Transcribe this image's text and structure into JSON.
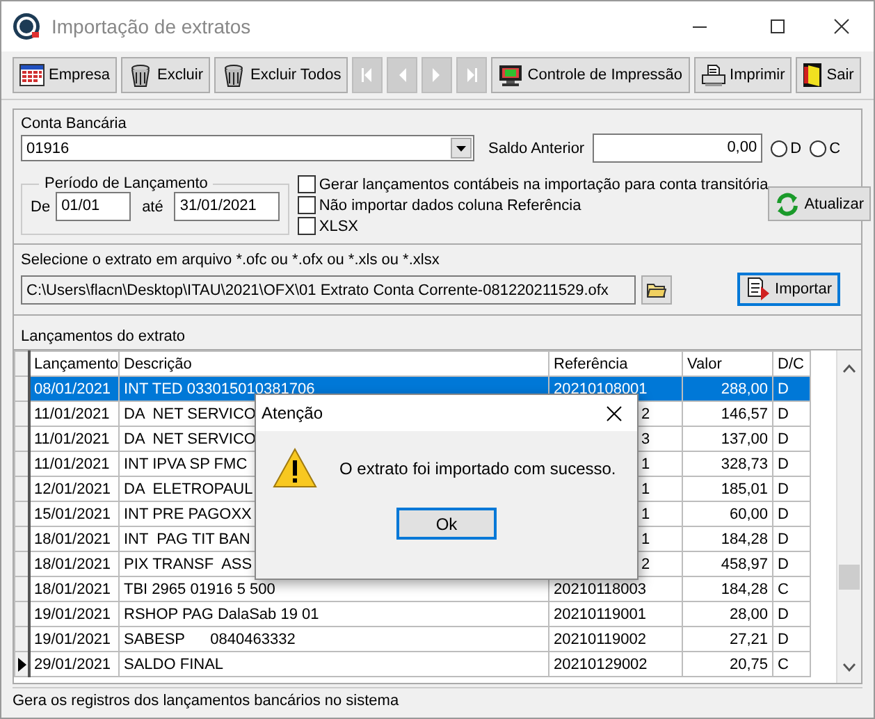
{
  "window": {
    "title": "Importação de extratos"
  },
  "toolbar": [
    {
      "kind": "calendar",
      "label": "Empresa",
      "disabled": false
    },
    {
      "kind": "trash",
      "label": "Excluir",
      "disabled": false
    },
    {
      "kind": "trash",
      "label": "Excluir Todos",
      "disabled": false
    },
    {
      "kind": "first",
      "disabled": true
    },
    {
      "kind": "prev",
      "disabled": true
    },
    {
      "kind": "next",
      "disabled": true
    },
    {
      "kind": "last",
      "disabled": true
    },
    {
      "kind": "monitor",
      "label": "Controle de Impressão",
      "disabled": false
    },
    {
      "kind": "printer",
      "label": "Imprimir",
      "disabled": false
    },
    {
      "kind": "exit",
      "label": "Sair",
      "disabled": false
    }
  ],
  "conta_bancaria": {
    "label": "Conta Bancária",
    "value": "01916"
  },
  "saldo_anterior": {
    "label": "Saldo Anterior",
    "value": "0,00"
  },
  "saldo_tipo": [
    {
      "label": "D",
      "selected": false
    },
    {
      "label": "C",
      "selected": false
    }
  ],
  "periodo": {
    "title": "Período de Lançamento",
    "from_label": "De",
    "from": "01/01",
    "to_label": "até",
    "to": "31/01/2021"
  },
  "options": [
    {
      "label": "Gerar lançamentos contábeis na importação para conta transitória",
      "checked": false
    },
    {
      "label": "Não importar dados coluna Referência",
      "checked": false
    },
    {
      "label": "XLSX",
      "checked": false
    }
  ],
  "atualizar_button": "Atualizar",
  "file": {
    "label": "Selecione o extrato em arquivo *.ofc ou *.ofx ou *.xls ou *.xlsx",
    "value": "C:\\Users\\flacn\\Desktop\\ITAU\\2021\\OFX\\01 Extrato Conta Corrente-081220211529.ofx"
  },
  "importar_button": "Importar",
  "entries": {
    "title": "Lançamentos do extrato",
    "columns": [
      "Lançamento",
      "Descrição",
      "Referência",
      "Valor",
      "D/C"
    ],
    "rows": [
      {
        "cells": [
          "08/01/2021",
          "INT TED 033015010381706",
          "20210108001",
          "288,00",
          "D"
        ],
        "selected": true,
        "current": false
      },
      {
        "cells": [
          "11/01/2021",
          "DA  NET SERVICO",
          "2",
          "146,57",
          "D"
        ],
        "selected": false,
        "current": false
      },
      {
        "cells": [
          "11/01/2021",
          "DA  NET SERVICO",
          "3",
          "137,00",
          "D"
        ],
        "selected": false,
        "current": false
      },
      {
        "cells": [
          "11/01/2021",
          "INT IPVA SP FMC",
          "1",
          "328,73",
          "D"
        ],
        "selected": false,
        "current": false
      },
      {
        "cells": [
          "12/01/2021",
          "DA  ELETROPAUL",
          "1",
          "185,01",
          "D"
        ],
        "selected": false,
        "current": false
      },
      {
        "cells": [
          "15/01/2021",
          "INT PRE PAGOXX",
          "1",
          "60,00",
          "D"
        ],
        "selected": false,
        "current": false
      },
      {
        "cells": [
          "18/01/2021",
          "INT  PAG TIT BAN",
          "1",
          "184,28",
          "D"
        ],
        "selected": false,
        "current": false
      },
      {
        "cells": [
          "18/01/2021",
          "PIX TRANSF  ASS",
          "2",
          "458,97",
          "D"
        ],
        "selected": false,
        "current": false
      },
      {
        "cells": [
          "18/01/2021",
          "TBI 2965 01916 5 500",
          "20210118003",
          "184,28",
          "C"
        ],
        "selected": false,
        "current": false
      },
      {
        "cells": [
          "19/01/2021",
          "RSHOP PAG DalaSab 19 01",
          "20210119001",
          "28,00",
          "D"
        ],
        "selected": false,
        "current": false
      },
      {
        "cells": [
          "19/01/2021",
          "SABESP      0840463332",
          "20210119002",
          "27,21",
          "D"
        ],
        "selected": false,
        "current": false
      },
      {
        "cells": [
          "29/01/2021",
          "SALDO FINAL",
          "20210129002",
          "20,75",
          "C"
        ],
        "selected": false,
        "current": true
      }
    ]
  },
  "dialog": {
    "title": "Atenção",
    "message": "O extrato foi importado com sucesso.",
    "button": "Ok"
  },
  "status_bar": "Gera os registros dos lançamentos bancários no sistema"
}
